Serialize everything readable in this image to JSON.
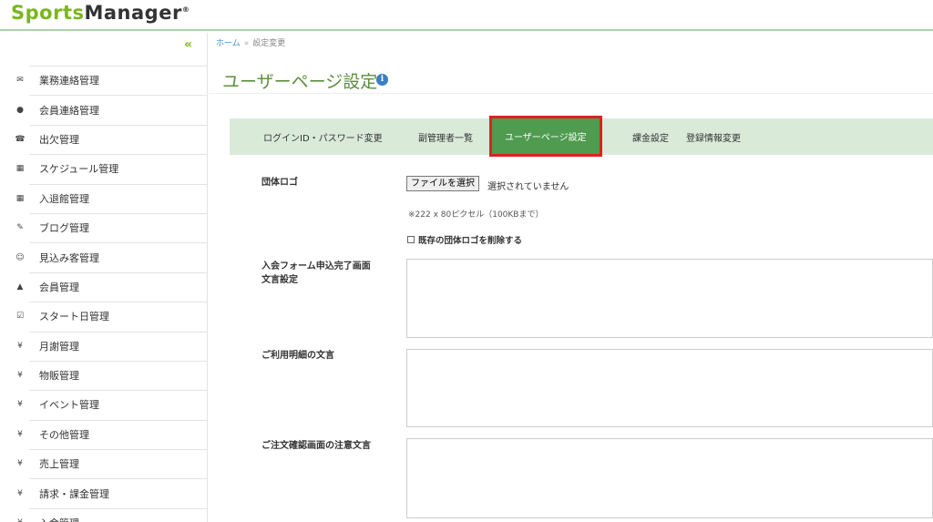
{
  "brand": {
    "part1": "Sports",
    "part2": "Manager",
    "mark": "®"
  },
  "sidebar": {
    "collapse_glyph": "«",
    "items": [
      {
        "icon": "envelope-icon",
        "label": "業務連絡管理",
        "glyph": "✉"
      },
      {
        "icon": "chat-bubble-icon",
        "label": "会員連絡管理",
        "glyph": "●"
      },
      {
        "icon": "phone-icon",
        "label": "出欠管理",
        "glyph": "☎"
      },
      {
        "icon": "calendar-icon",
        "label": "スケジュール管理",
        "glyph": "▦"
      },
      {
        "icon": "calendar-icon",
        "label": "入退館管理",
        "glyph": "▦"
      },
      {
        "icon": "pencil-icon",
        "label": "ブログ管理",
        "glyph": "✎"
      },
      {
        "icon": "smiley-icon",
        "label": "見込み客管理",
        "glyph": "☺"
      },
      {
        "icon": "user-icon",
        "label": "会員管理",
        "glyph": "▲"
      },
      {
        "icon": "checkbox-icon",
        "label": "スタート日管理",
        "glyph": "☑"
      },
      {
        "icon": "yen-icon",
        "label": "月謝管理",
        "glyph": "¥"
      },
      {
        "icon": "yen-icon",
        "label": "物販管理",
        "glyph": "¥"
      },
      {
        "icon": "yen-icon",
        "label": "イベント管理",
        "glyph": "¥"
      },
      {
        "icon": "yen-icon",
        "label": "その他管理",
        "glyph": "¥"
      },
      {
        "icon": "yen-icon",
        "label": "売上管理",
        "glyph": "¥"
      },
      {
        "icon": "yen-icon",
        "label": "請求・課金管理",
        "glyph": "¥"
      },
      {
        "icon": "yen-icon",
        "label": "入金管理",
        "glyph": "¥"
      }
    ]
  },
  "breadcrumb": {
    "home": "ホーム",
    "sep": "»",
    "current": "設定変更"
  },
  "page": {
    "title": "ユーザーページ設定",
    "info_glyph": "i"
  },
  "tabs": [
    {
      "label": "ログインID・パスワード変更"
    },
    {
      "label": "副管理者一覧"
    },
    {
      "label": "ユーザーページ設定"
    },
    {
      "label": "課金設定"
    },
    {
      "label": "登録情報変更"
    }
  ],
  "form": {
    "logo_label": "団体ロゴ",
    "file_button": "ファイルを選択",
    "file_status": "選択されていません",
    "size_hint": "※222 x 80ピクセル（100KBまで）",
    "delete_logo_label": "既存の団体ロゴを削除する",
    "form_text_label_line1": "入会フォーム申込完了画面",
    "form_text_label_line2": "文言設定",
    "usage_text_label": "ご利用明細の文言",
    "order_note_label": "ご注文確認画面の注意文言"
  },
  "colors": {
    "accent_green": "#5a8f3c",
    "tab_bar": "#d9ead9",
    "active_tab": "#4f9b50",
    "highlight": "#e02020"
  }
}
